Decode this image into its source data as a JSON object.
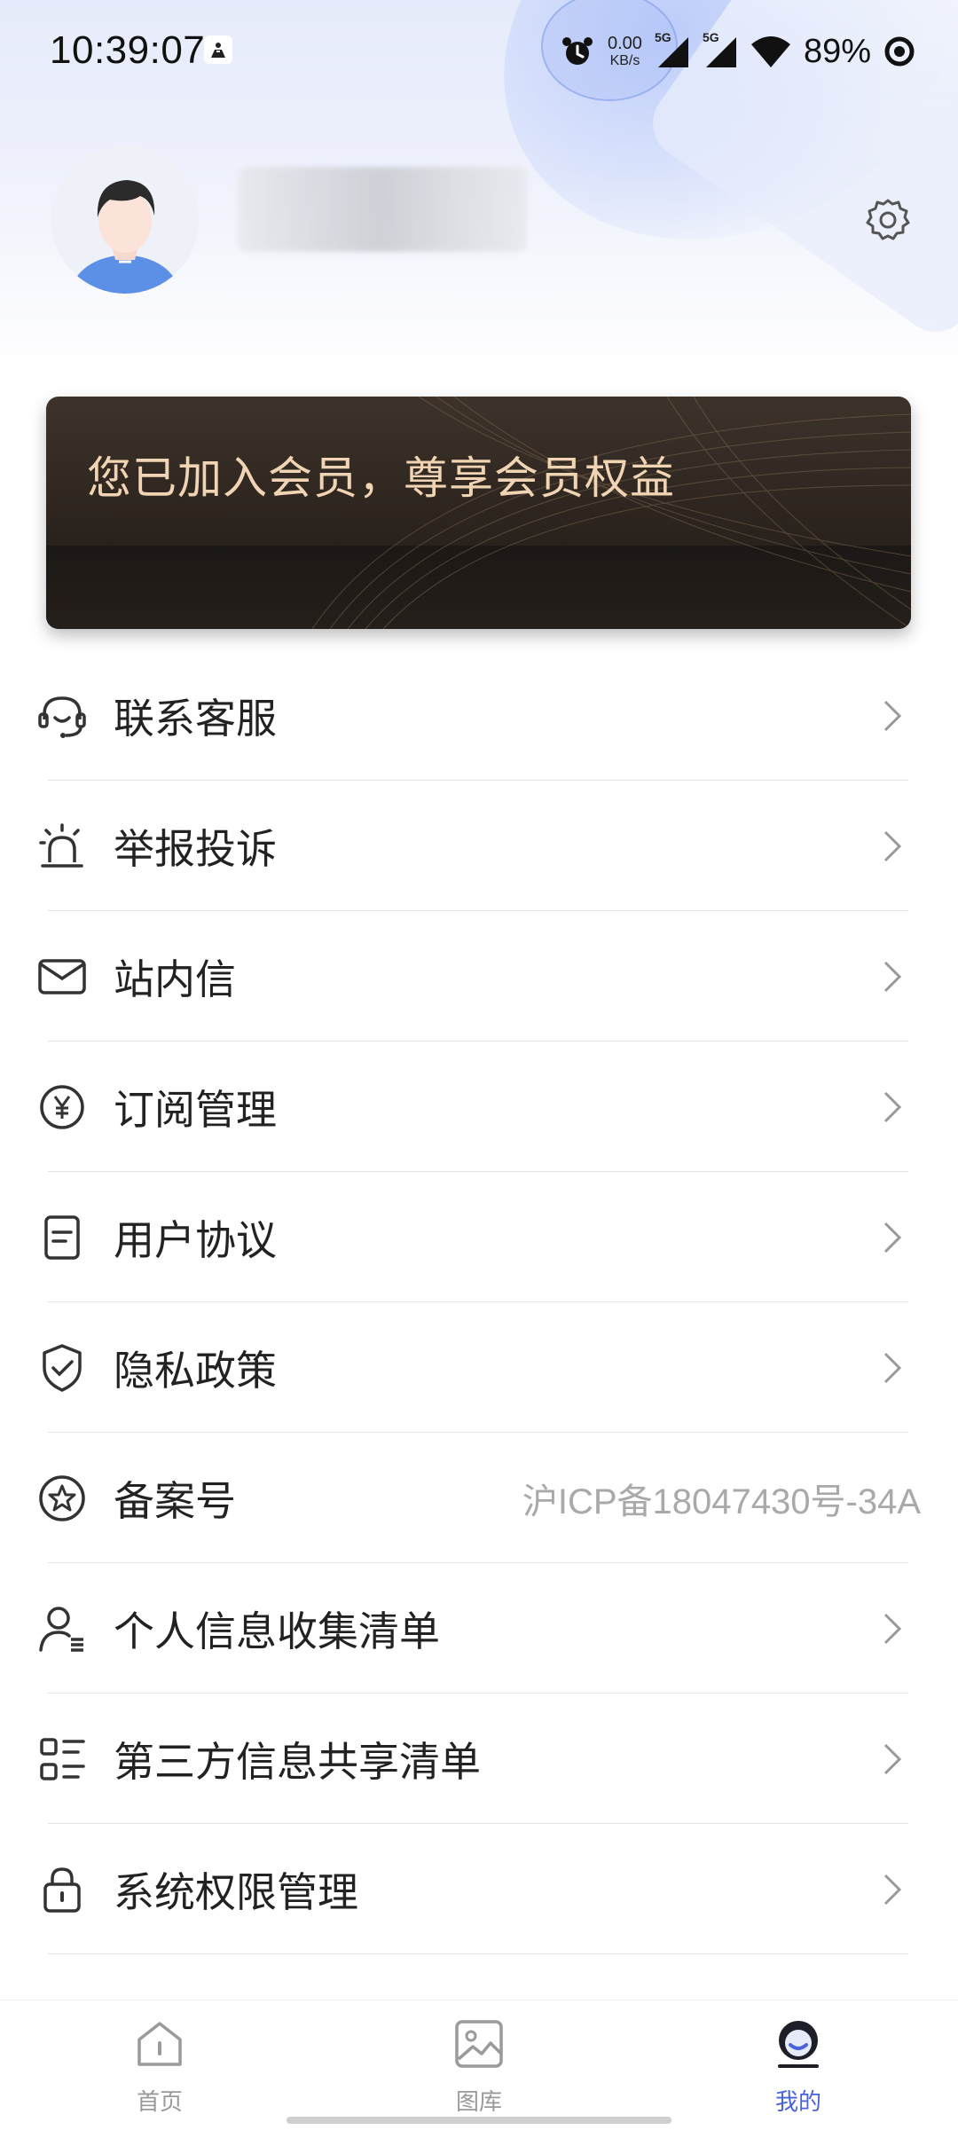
{
  "status_bar": {
    "time": "10:39:07",
    "net_speed_value": "0.00",
    "net_speed_unit": "KB/s",
    "signal_1": "5G",
    "signal_2": "5G",
    "battery": "89%"
  },
  "profile": {
    "avatar_icon": "user-avatar",
    "settings_icon": "gear-icon"
  },
  "member_banner": {
    "text": "您已加入会员，尊享会员权益",
    "text_color": "#f1d4b4"
  },
  "menu": {
    "items": [
      {
        "label": "联系客服",
        "icon": "headset-icon"
      },
      {
        "label": "举报投诉",
        "icon": "alarm-icon"
      },
      {
        "label": "站内信",
        "icon": "mail-icon"
      },
      {
        "label": "订阅管理",
        "icon": "yen-coin-icon"
      },
      {
        "label": "用户协议",
        "icon": "document-icon"
      },
      {
        "label": "隐私政策",
        "icon": "shield-check-icon"
      },
      {
        "label": "备案号",
        "icon": "star-circle-icon",
        "value": "沪ICP备18047430号-34A"
      },
      {
        "label": "个人信息收集清单",
        "icon": "person-list-icon"
      },
      {
        "label": "第三方信息共享清单",
        "icon": "list-grid-icon"
      },
      {
        "label": "系统权限管理",
        "icon": "lock-icon"
      }
    ]
  },
  "tabbar": {
    "tabs": [
      {
        "label": "首页",
        "icon": "home-icon"
      },
      {
        "label": "图库",
        "icon": "gallery-icon"
      },
      {
        "label": "我的",
        "icon": "profile-icon",
        "active": true
      }
    ],
    "active_color": "#4a63d8"
  }
}
